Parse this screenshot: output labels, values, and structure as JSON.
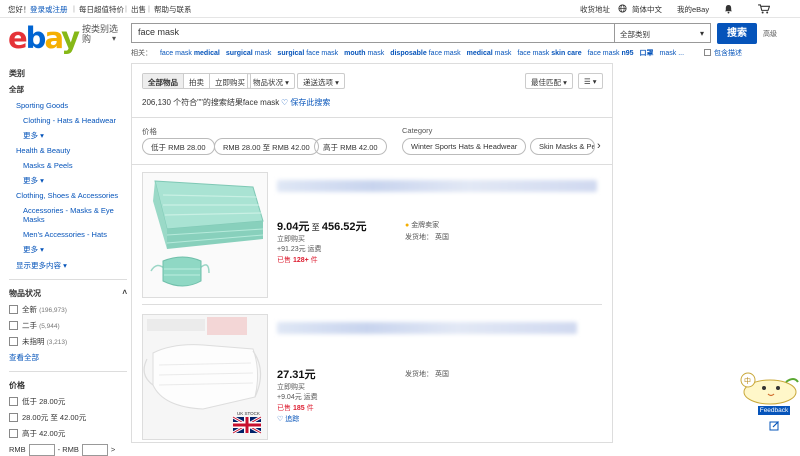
{
  "topbar": {
    "greeting": "您好！",
    "signin": "登录或注册",
    "daily_deals": "每日超值特价",
    "sell": "出售",
    "help": "帮助与联系",
    "ship_to": "收货地址",
    "language": "简体中文",
    "my_ebay": "我的eBay",
    "icons": [
      "globe-icon",
      "bell-icon",
      "cart-icon"
    ]
  },
  "header": {
    "logo": "ebay",
    "shop_by": "按类别选购",
    "search_value": "face mask",
    "category_select": "全部类别",
    "search_button": "搜索",
    "advanced": "高级"
  },
  "related": {
    "label": "相关：",
    "items": [
      {
        "pre": "face mask ",
        "bold": "medical",
        "post": ""
      },
      {
        "pre": "",
        "bold": "surgical",
        "post": " mask"
      },
      {
        "pre": "",
        "bold": "surgical",
        "post": " face mask"
      },
      {
        "pre": "",
        "bold": "mouth",
        "post": " mask"
      },
      {
        "pre": "",
        "bold": "disposable",
        "post": " face mask"
      },
      {
        "pre": "",
        "bold": "medical",
        "post": " mask"
      },
      {
        "pre": "face mask ",
        "bold": "skin care",
        "post": ""
      },
      {
        "pre": "face mask ",
        "bold": "n95",
        "post": ""
      },
      {
        "pre": "",
        "bold": "口罩",
        "post": ""
      },
      {
        "pre": "mask",
        "bold": "",
        "post": " ..."
      }
    ],
    "include_desc": "包含描述"
  },
  "sidebar": {
    "category_heading": "类别",
    "all": "全部",
    "categories": [
      {
        "label": "Sporting Goods",
        "level": 1
      },
      {
        "label": "Clothing - Hats & Headwear",
        "level": 2
      },
      {
        "label": "更多 ▾",
        "level": 2
      },
      {
        "label": "Health & Beauty",
        "level": 1
      },
      {
        "label": "Masks & Peels",
        "level": 2
      },
      {
        "label": "更多 ▾",
        "level": 2
      },
      {
        "label": "Clothing, Shoes & Accessories",
        "level": 1
      },
      {
        "label": "Accessories - Masks & Eye Masks",
        "level": 2
      },
      {
        "label": "Men's Accessories - Hats",
        "level": 2
      },
      {
        "label": "更多 ▾",
        "level": 2
      },
      {
        "label": "显示更多内容 ▾",
        "level": 1
      }
    ],
    "condition_heading": "物品状况",
    "conditions": [
      {
        "label": "全新",
        "count": "(196,973)"
      },
      {
        "label": "二手",
        "count": "(5,944)"
      },
      {
        "label": "未指明",
        "count": "(3,213)"
      }
    ],
    "see_all": "查看全部",
    "price_heading": "价格",
    "prices": [
      "低于 28.00元",
      "28.00元 至 42.00元",
      "高于 42.00元"
    ],
    "price_from": "RMB",
    "price_to": "- RMB",
    "go": ">"
  },
  "results": {
    "tabs": [
      "全部物品",
      "拍卖",
      "立即购买"
    ],
    "condition_dd": "物品状况 ▾",
    "shipping_dd": "递送选项 ▾",
    "sort_dd": "最佳匹配 ▾",
    "view_dd": "☰ ▾",
    "count": "206,130 个符合\"\"的搜索结果face mask",
    "save_search": "保存此搜索",
    "price_label": "价格",
    "price_pills": [
      "低于 RMB 28.00",
      "RMB 28.00 至 RMB 42.00",
      "高于 RMB 42.00"
    ],
    "category_label": "Category",
    "category_pills": [
      "Winter Sports Hats & Headwear",
      "Skin Masks & Pe"
    ]
  },
  "items": [
    {
      "title": "...MASK",
      "price_main": "9.04元",
      "price_sep": " 至 ",
      "price_max": "456.52元",
      "buy_now": "立即购买",
      "shipping": "+91.23元 运费",
      "sold_prefix": "已售 ",
      "sold_count": "128+",
      "sold_suffix": " 件",
      "badge": "金牌卖家",
      "location": "发货地： 英国"
    },
    {
      "title": "",
      "price_main": "27.31元",
      "buy_now": "立即购买",
      "shipping": "+9.04元 运费",
      "sold_prefix": "已售 ",
      "sold_count": "185",
      "sold_suffix": " 件",
      "location": "发货地： 英国",
      "watch": "追踪",
      "flag_label": "UK STOCK"
    }
  ],
  "feedback": "Feedback",
  "colors": {
    "ebay_blue": "#0654ba",
    "sold_red": "#dd1e31",
    "mask_green": "#8fd8c4"
  }
}
